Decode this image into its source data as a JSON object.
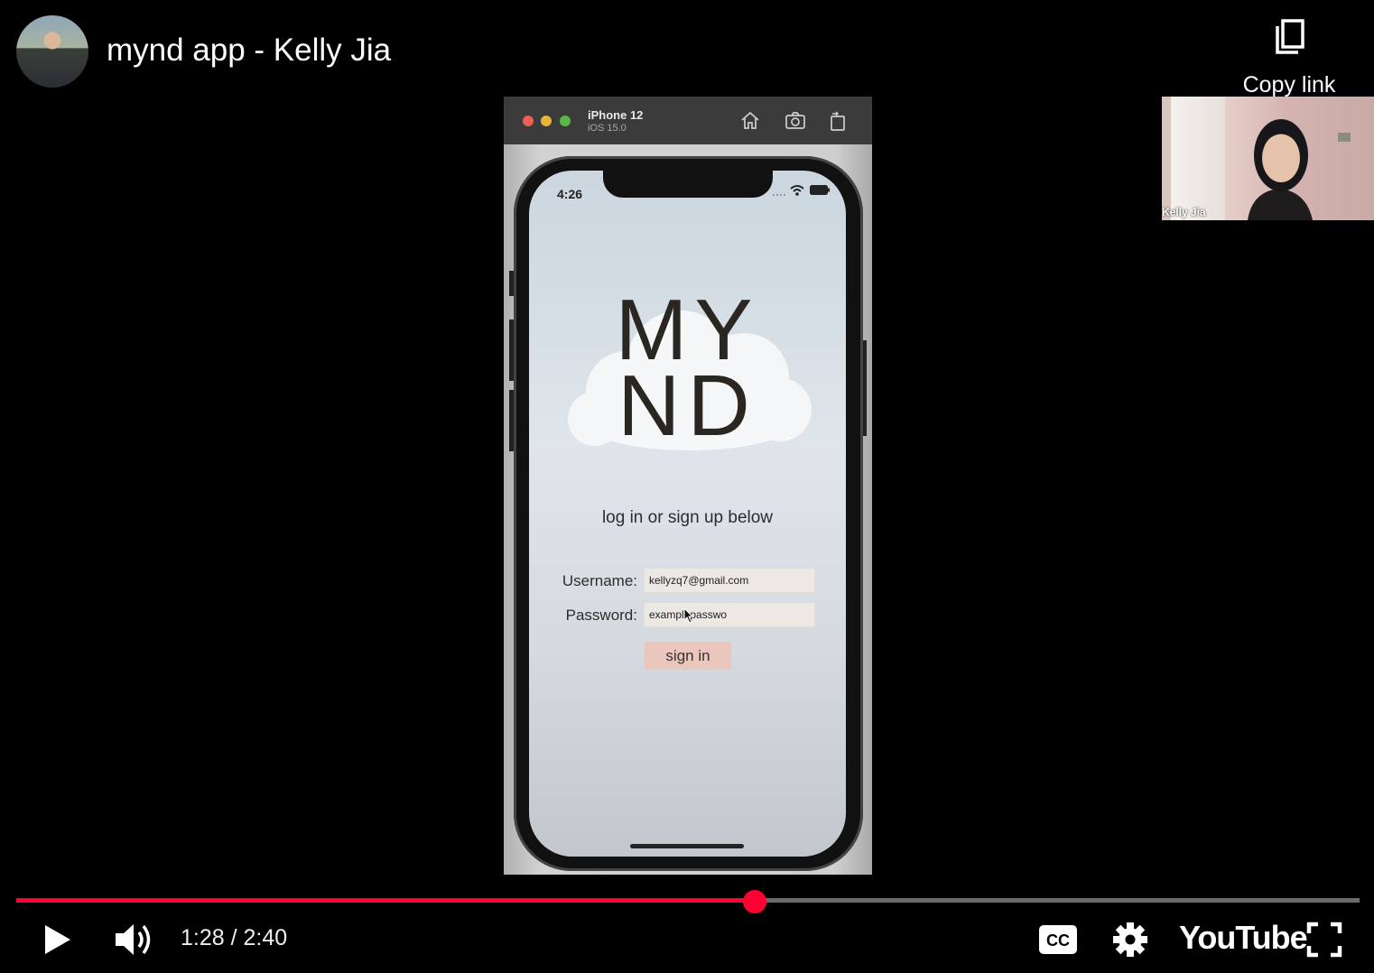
{
  "header": {
    "video_title": "mynd app - Kelly Jia",
    "copy_link_label": "Copy link"
  },
  "simulator": {
    "device_name": "iPhone 12",
    "os_version": "iOS 15.0",
    "icons": [
      "home-icon",
      "screenshot-icon",
      "rotate-icon"
    ]
  },
  "phone": {
    "status_time": "4:26",
    "logo_line1": "MY",
    "logo_line2": "ND",
    "tagline": "log in or sign up below",
    "username_label": "Username:",
    "username_value": "kellyzq7@gmail.com",
    "password_label": "Password:",
    "password_value": "examplepasswo",
    "signin_label": "sign in"
  },
  "webcam": {
    "participant_name": "Kelly Jia"
  },
  "player": {
    "time_display": "1:28 / 2:40",
    "progress_fraction": 0.55,
    "accent_color": "#ff0033",
    "logo_text": "YouTube",
    "icons": [
      "play-icon",
      "volume-icon",
      "cc-icon",
      "settings-icon",
      "fullscreen-icon"
    ]
  }
}
